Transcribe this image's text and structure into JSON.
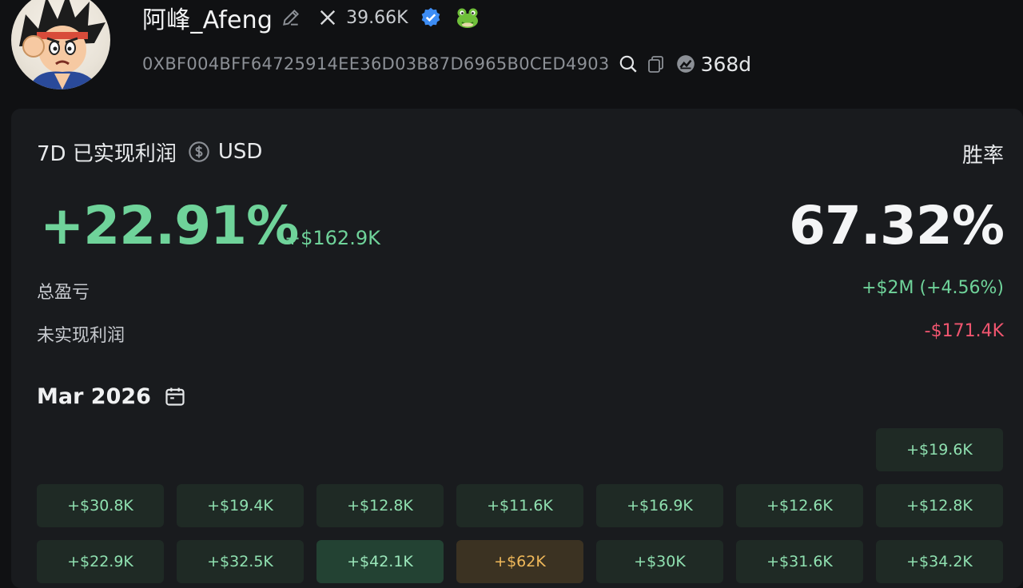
{
  "profile": {
    "name": "阿峰_Afeng",
    "followers": "39.66K",
    "address": "0XBF004BFF64725914EE36D03B87D6965B0CED4903",
    "age": "368d",
    "icons": {
      "edit": "edit-pencil-icon",
      "x": "x-logo-icon",
      "verified": "verified-badge-icon",
      "frog": "frog-icon",
      "search": "search-icon",
      "copy": "copy-icon",
      "chart": "chart-icon"
    }
  },
  "stats": {
    "title": "7D 已实现利润",
    "currency": "USD",
    "winrate_label": "胜率",
    "pct": "+22.91%",
    "profit": "+$162.9K",
    "winrate": "67.32%",
    "total_label": "总盈亏",
    "total_value": "+$2M (+4.56%)",
    "unrealized_label": "未实现利润",
    "unrealized_value": "-$171.4K"
  },
  "calendar": {
    "month": "Mar 2026",
    "rows": [
      [
        null,
        null,
        null,
        null,
        null,
        null,
        {
          "v": "+$19.6K",
          "tone": "normal"
        }
      ],
      [
        {
          "v": "+$30.8K",
          "tone": "normal"
        },
        {
          "v": "+$19.4K",
          "tone": "normal"
        },
        {
          "v": "+$12.8K",
          "tone": "normal"
        },
        {
          "v": "+$11.6K",
          "tone": "normal"
        },
        {
          "v": "+$16.9K",
          "tone": "normal"
        },
        {
          "v": "+$12.6K",
          "tone": "normal"
        },
        {
          "v": "+$12.8K",
          "tone": "normal"
        }
      ],
      [
        {
          "v": "+$22.9K",
          "tone": "normal"
        },
        {
          "v": "+$32.5K",
          "tone": "normal"
        },
        {
          "v": "+$42.1K",
          "tone": "medium"
        },
        {
          "v": "+$62K",
          "tone": "gold"
        },
        {
          "v": "+$30K",
          "tone": "normal"
        },
        {
          "v": "+$31.6K",
          "tone": "normal"
        },
        {
          "v": "+$34.2K",
          "tone": "normal"
        }
      ]
    ]
  },
  "colors": {
    "positive": "#6fd39a",
    "negative": "#f0556f",
    "highlight": "#f0b95a",
    "verified": "#3d8df5"
  }
}
